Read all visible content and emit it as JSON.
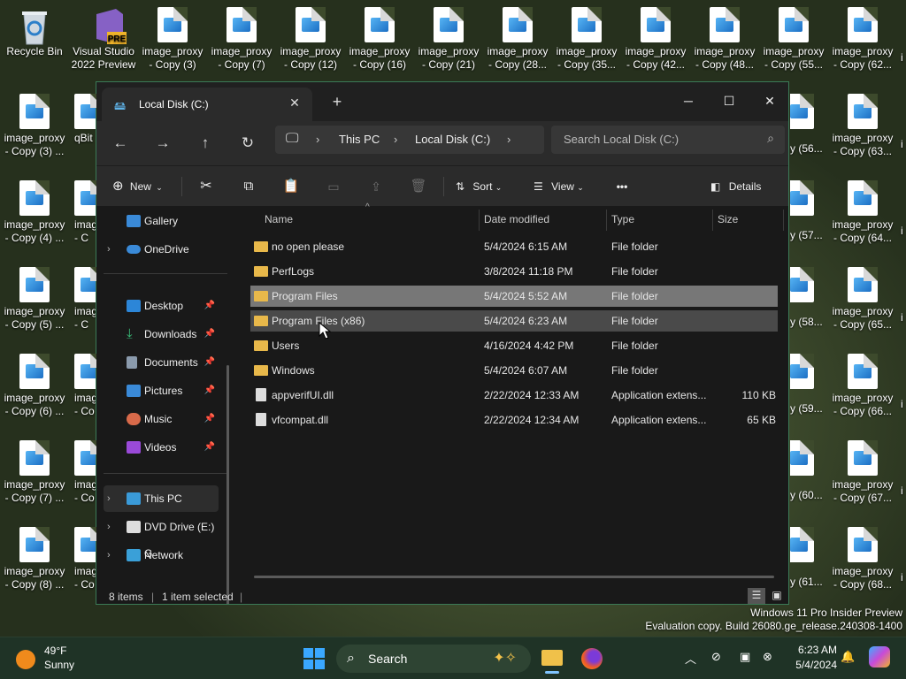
{
  "desktop": {
    "recycle_bin": "Recycle Bin",
    "vs_label": "Visual Studio 2022 Preview",
    "vs_badge": "PRE",
    "top_row": [
      "image_proxy - Copy (3)",
      "image_proxy - Copy (7)",
      "image_proxy - Copy (12)",
      "image_proxy - Copy (16)",
      "image_proxy - Copy (21)",
      "image_proxy - Copy (28...",
      "image_proxy - Copy (35...",
      "image_proxy - Copy (42...",
      "image_proxy - Copy (48...",
      "image_proxy - Copy (55...",
      "image_proxy - Copy (62..."
    ],
    "col1": [
      "image_proxy - Copy (3) ...",
      "image_proxy - Copy (4) ...",
      "image_proxy - Copy (5) ...",
      "image_proxy - Copy (6) ...",
      "image_proxy - Copy (7) ...",
      "image_proxy - Copy (8) ..."
    ],
    "col2_partial": [
      "qBit",
      "imag - C",
      "imag - C",
      "imag - Co",
      "imag - Co",
      "imag - Co"
    ],
    "col_right_partial": [
      "y (56...",
      "y (57...",
      "y (58...",
      "y (59...",
      "y (60...",
      "y (61..."
    ],
    "col_right": [
      "image_proxy - Copy (63...",
      "image_proxy - Copy (64...",
      "image_proxy - Copy (65...",
      "image_proxy - Copy (66...",
      "image_proxy - Copy (67...",
      "image_proxy - Copy (68..."
    ],
    "edge_partial": "i"
  },
  "window": {
    "tab_title": "Local Disk (C:)",
    "new_tab": "+",
    "close_tab": "✕",
    "breadcrumb": [
      "This PC",
      "Local Disk (C:)"
    ],
    "search_placeholder": "Search Local Disk (C:)",
    "toolbar": {
      "new": "New",
      "sort": "Sort",
      "view": "View",
      "more": "•••",
      "details": "Details"
    },
    "nav": {
      "gallery": "Gallery",
      "onedrive": "OneDrive",
      "desktop": "Desktop",
      "downloads": "Downloads",
      "documents": "Documents",
      "pictures": "Pictures",
      "music": "Music",
      "videos": "Videos",
      "thispc": "This PC",
      "dvd": "DVD Drive (E:) G",
      "network": "Network"
    },
    "columns": [
      "Name",
      "Date modified",
      "Type",
      "Size"
    ],
    "rows": [
      {
        "name": "no open please",
        "date": "5/4/2024 6:15 AM",
        "type": "File folder",
        "size": ""
      },
      {
        "name": "PerfLogs",
        "date": "3/8/2024 11:18 PM",
        "type": "File folder",
        "size": ""
      },
      {
        "name": "Program Files",
        "date": "5/4/2024 5:52 AM",
        "type": "File folder",
        "size": ""
      },
      {
        "name": "Program Files (x86)",
        "date": "5/4/2024 6:23 AM",
        "type": "File folder",
        "size": ""
      },
      {
        "name": "Users",
        "date": "4/16/2024 4:42 PM",
        "type": "File folder",
        "size": ""
      },
      {
        "name": "Windows",
        "date": "5/4/2024 6:07 AM",
        "type": "File folder",
        "size": ""
      },
      {
        "name": "appverifUI.dll",
        "date": "2/22/2024 12:33 AM",
        "type": "Application extens...",
        "size": "110 KB"
      },
      {
        "name": "vfcompat.dll",
        "date": "2/22/2024 12:34 AM",
        "type": "Application extens...",
        "size": "65 KB"
      }
    ],
    "status": {
      "items": "8 items",
      "selected": "1 item selected"
    }
  },
  "watermark": {
    "line1": "Windows 11 Pro Insider Preview",
    "line2": "Evaluation copy. Build 26080.ge_release.240308-1400"
  },
  "taskbar": {
    "temp": "49°F",
    "weather": "Sunny",
    "search": "Search",
    "time": "6:23 AM",
    "date": "5/4/2024"
  },
  "colors": {
    "folder": "#e8b84a",
    "selected_row": "#777777",
    "accent": "#0078d4",
    "window_border": "#3b7a57"
  }
}
